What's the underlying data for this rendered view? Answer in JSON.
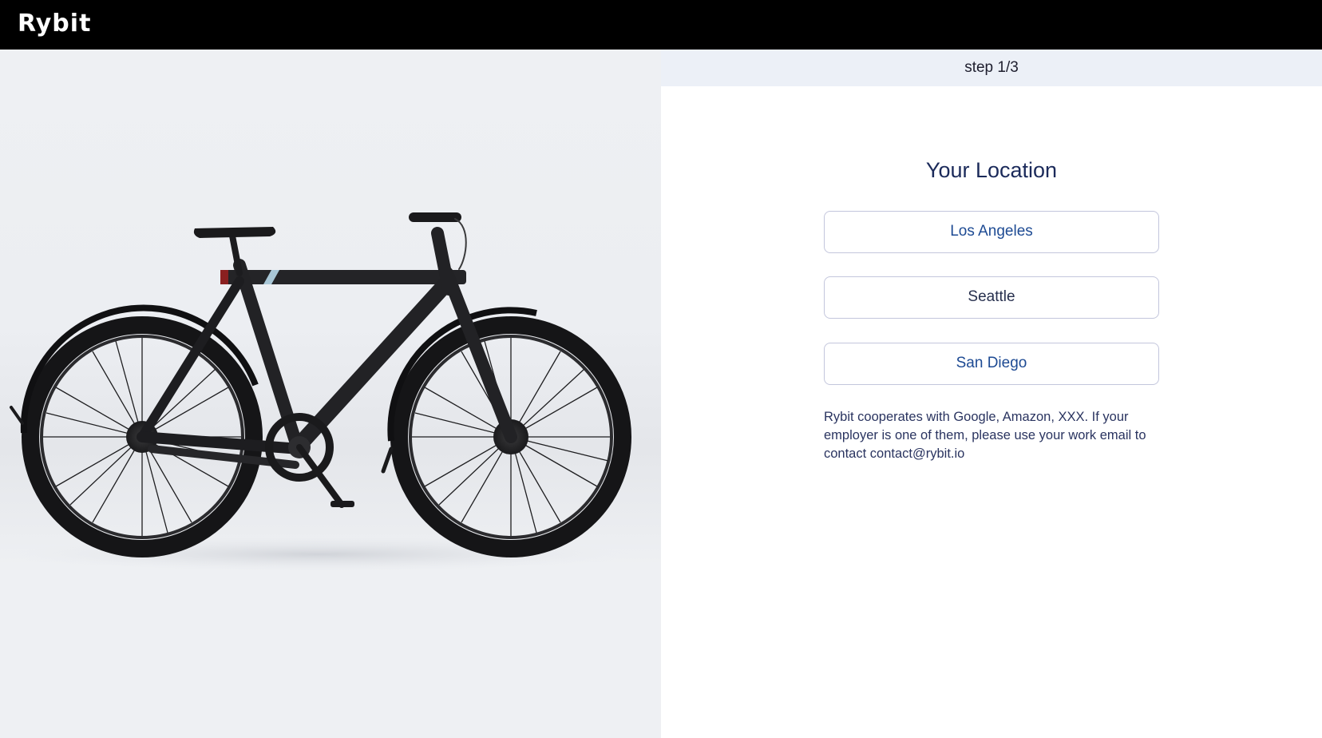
{
  "header": {
    "logo_text": "Rybit"
  },
  "step": {
    "label": "step 1/3"
  },
  "location": {
    "title": "Your Location",
    "options": [
      {
        "label": "Los Angeles"
      },
      {
        "label": "Seattle"
      },
      {
        "label": "San Diego"
      }
    ],
    "note": "Rybit cooperates with Google, Amazon, XXX. If your employer is one of them, please use your work email to contact contact@rybit.io"
  },
  "colors": {
    "header_bg": "#000000",
    "step_bar_bg": "#ecf0f7",
    "accent_blue": "#1d4a93",
    "title_color": "#1b2a5a"
  },
  "image": {
    "subject": "black-bicycle"
  }
}
